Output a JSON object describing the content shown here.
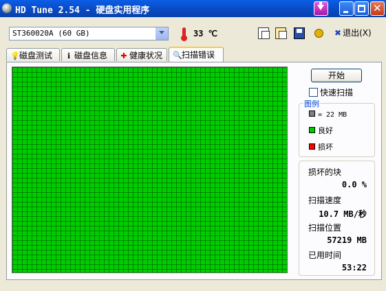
{
  "window": {
    "title": "HD Tune 2.54 - 硬盘实用程序"
  },
  "toolbar": {
    "drive": "ST360020A (60 GB)",
    "temperature": "33 ℃",
    "exit_label": "退出(X)"
  },
  "tabs": [
    {
      "label": "磁盘测试",
      "icon": "benchmark-icon"
    },
    {
      "label": "磁盘信息",
      "icon": "info-icon"
    },
    {
      "label": "健康状况",
      "icon": "health-icon"
    },
    {
      "label": "扫描错误",
      "icon": "search-icon",
      "active": true
    }
  ],
  "scan": {
    "start_label": "开始",
    "quick_scan_label": "快速扫描",
    "quick_scan_checked": false,
    "block_color_good": "#00cc00",
    "legend": {
      "title": "图例",
      "block_size": "= 22 MB",
      "good": "良好",
      "bad": "损坏"
    },
    "colors": {
      "block_size": "#808080",
      "good": "#00cc00",
      "bad": "#ff0000"
    }
  },
  "stats": {
    "bad_blocks_label": "损坏的块",
    "bad_blocks_value": "0.0 %",
    "speed_label": "扫描速度",
    "speed_value": "10.7 MB/秒",
    "position_label": "扫描位置",
    "position_value": "57219 MB",
    "elapsed_label": "已用时间",
    "elapsed_value": "53:22"
  }
}
